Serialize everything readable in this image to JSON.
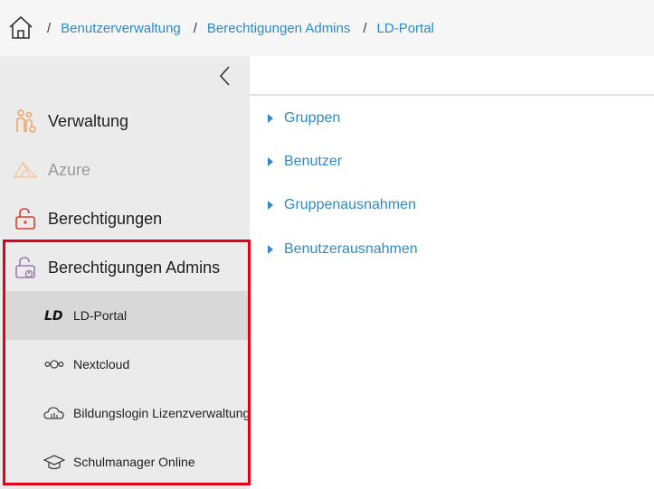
{
  "breadcrumb": {
    "separator": "/",
    "items": [
      "Benutzerverwaltung",
      "Berechtigungen Admins",
      "LD-Portal"
    ]
  },
  "sidebar": {
    "items": [
      {
        "label": "Verwaltung",
        "icon": "people-icon"
      },
      {
        "label": "Azure",
        "icon": "azure-icon"
      },
      {
        "label": "Berechtigungen",
        "icon": "unlock-icon"
      },
      {
        "label": "Berechtigungen Admins",
        "icon": "admin-unlock-icon"
      }
    ],
    "subitems": [
      {
        "label": "LD-Portal",
        "icon": "ld-logo-icon"
      },
      {
        "label": "Nextcloud",
        "icon": "nextcloud-icon"
      },
      {
        "label": "Bildungslogin Lizenzverwaltung",
        "icon": "cloud-icon"
      },
      {
        "label": "Schulmanager Online",
        "icon": "graduation-cap-icon"
      }
    ]
  },
  "content": {
    "sections": [
      "Gruppen",
      "Benutzer",
      "Gruppenausnahmen",
      "Benutzerausnahmen"
    ]
  },
  "colors": {
    "link": "#2f8ac6",
    "highlight": "#e3001b",
    "accent_orange": "#f0a35e",
    "accent_red": "#e03c2c",
    "accent_purple": "#9c7bb0"
  }
}
